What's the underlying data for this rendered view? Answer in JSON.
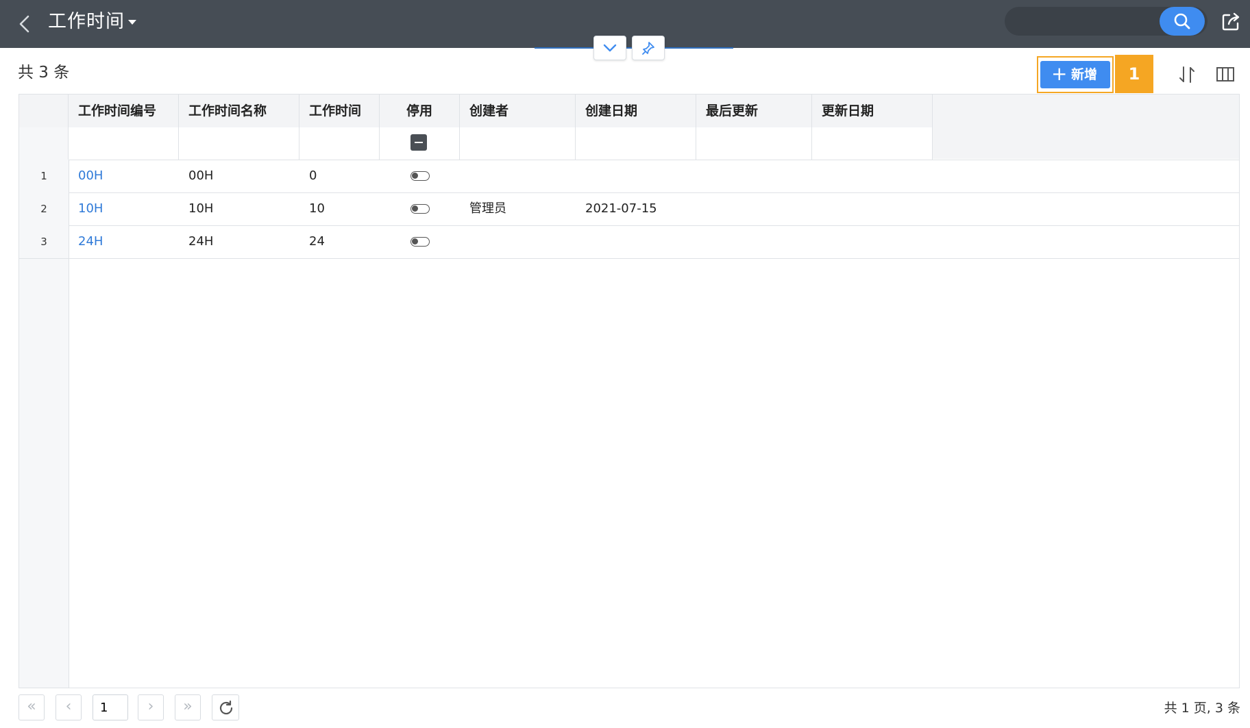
{
  "header": {
    "title": "工作时间",
    "search": {
      "placeholder": "",
      "value": ""
    }
  },
  "toolbar": {
    "total_label": "共 3 条",
    "add_label": "新增",
    "add_icon": "+",
    "badge": "1",
    "accent_color": "#3f8cf0",
    "highlight_color": "#f5a623"
  },
  "table": {
    "columns": [
      "工作时间编号",
      "工作时间名称",
      "工作时间",
      "停用",
      "创建者",
      "创建日期",
      "最后更新",
      "更新日期"
    ],
    "rows": [
      {
        "num": "1",
        "code": "00H",
        "name": "00H",
        "hours": "0",
        "disabled": false,
        "creator": "",
        "created": "",
        "updated_by": "",
        "updated": ""
      },
      {
        "num": "2",
        "code": "10H",
        "name": "10H",
        "hours": "10",
        "disabled": false,
        "creator": "管理员",
        "created": "2021-07-15",
        "updated_by": "",
        "updated": ""
      },
      {
        "num": "3",
        "code": "24H",
        "name": "24H",
        "hours": "24",
        "disabled": false,
        "creator": "",
        "created": "",
        "updated_by": "",
        "updated": ""
      }
    ]
  },
  "pager": {
    "first": "«",
    "prev": "‹",
    "next": "›",
    "last": "»",
    "current_page": "1",
    "summary": "共 1 页, 3 条"
  }
}
